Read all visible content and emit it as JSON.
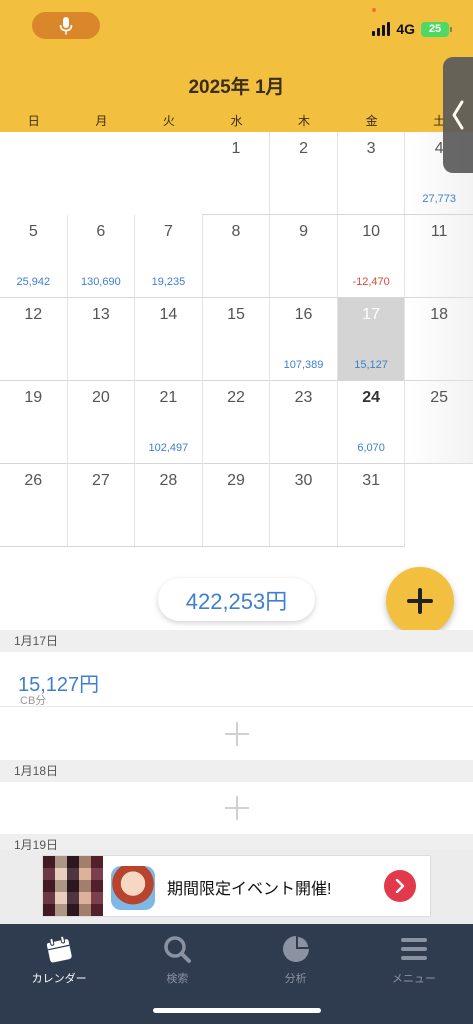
{
  "status_bar": {
    "network": "4G",
    "battery": "25"
  },
  "calendar": {
    "title": "2025年 1月",
    "weekdays": [
      "日",
      "月",
      "火",
      "水",
      "木",
      "金",
      "土"
    ],
    "weeks": [
      [
        {
          "d": ""
        },
        {
          "d": ""
        },
        {
          "d": ""
        },
        {
          "d": "1"
        },
        {
          "d": "2"
        },
        {
          "d": "3"
        },
        {
          "d": "4",
          "amt": "27,773"
        }
      ],
      [
        {
          "d": "5",
          "amt": "25,942"
        },
        {
          "d": "6",
          "amt": "130,690"
        },
        {
          "d": "7",
          "amt": "19,235"
        },
        {
          "d": "8"
        },
        {
          "d": "9"
        },
        {
          "d": "10",
          "amt": "-12,470",
          "neg": true
        },
        {
          "d": "11"
        }
      ],
      [
        {
          "d": "12"
        },
        {
          "d": "13"
        },
        {
          "d": "14"
        },
        {
          "d": "15"
        },
        {
          "d": "16",
          "amt": "107,389"
        },
        {
          "d": "17",
          "amt": "15,127",
          "selected": true
        },
        {
          "d": "18"
        }
      ],
      [
        {
          "d": "19"
        },
        {
          "d": "20"
        },
        {
          "d": "21",
          "amt": "102,497"
        },
        {
          "d": "22"
        },
        {
          "d": "23"
        },
        {
          "d": "24",
          "amt": "6,070",
          "today": true
        },
        {
          "d": "25"
        }
      ],
      [
        {
          "d": "26"
        },
        {
          "d": "27"
        },
        {
          "d": "28"
        },
        {
          "d": "29"
        },
        {
          "d": "30"
        },
        {
          "d": "31"
        },
        {
          "d": ""
        }
      ]
    ]
  },
  "summary": {
    "total": "422,253円"
  },
  "day_list": {
    "d17_header": "1月17日",
    "d17_amount": "15,127円",
    "d17_note": "CB分",
    "d18_header": "1月18日",
    "d19_header": "1月19日"
  },
  "ad": {
    "text": "期間限定イベント開催!"
  },
  "tabs": [
    {
      "label": "カレンダー",
      "icon": "calendar-icon",
      "active": true
    },
    {
      "label": "検索",
      "icon": "search-icon"
    },
    {
      "label": "分析",
      "icon": "pie-chart-icon"
    },
    {
      "label": "メニュー",
      "icon": "menu-icon"
    }
  ],
  "colors": {
    "header": "#f2bf3e",
    "positive": "#3f7fd0",
    "negative": "#d9493b",
    "tabbar": "#2f3b4f"
  }
}
